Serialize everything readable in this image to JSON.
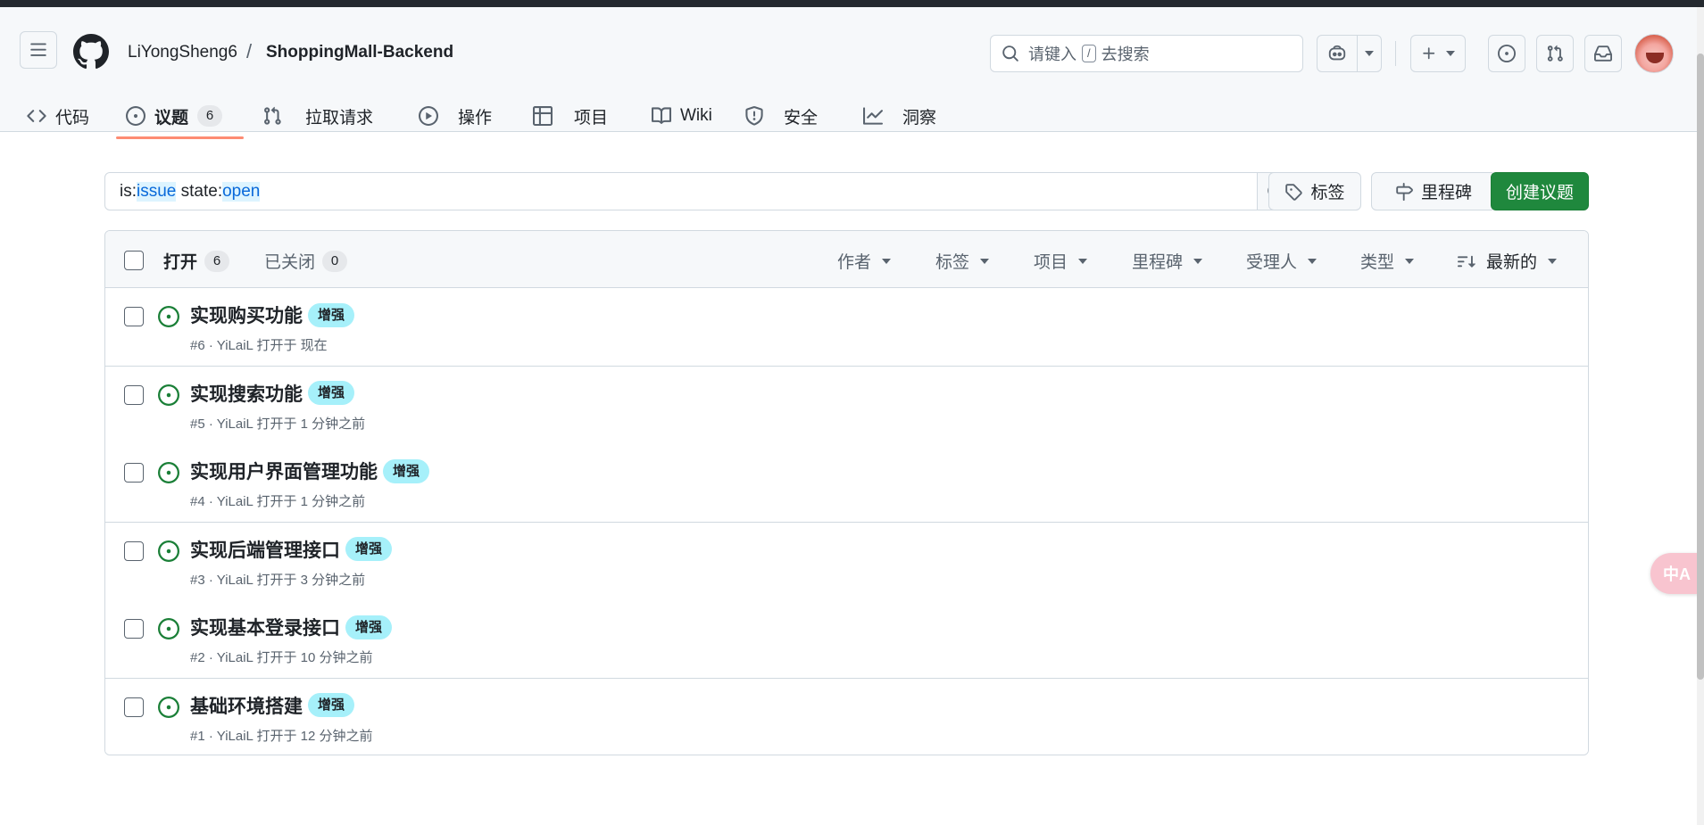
{
  "header": {
    "owner": "LiYongSheng6",
    "separator": "/",
    "repo": "ShoppingMall-Backend",
    "search": {
      "prefix": "请键入",
      "slash": "/",
      "suffix": "去搜索"
    }
  },
  "tabs": [
    {
      "label": "代码",
      "icon": "code-icon"
    },
    {
      "label": "议题",
      "icon": "issue-opened-icon",
      "count": "6",
      "active": true
    },
    {
      "label": "拉取请求",
      "icon": "git-pull-request-icon"
    },
    {
      "label": "操作",
      "icon": "play-icon"
    },
    {
      "label": "项目",
      "icon": "table-icon"
    },
    {
      "label": "Wiki",
      "icon": "book-icon"
    },
    {
      "label": "安全",
      "icon": "shield-icon"
    },
    {
      "label": "洞察",
      "icon": "graph-icon"
    }
  ],
  "toolbar": {
    "query": {
      "t1": "is:",
      "k1": "issue",
      "t2": " state:",
      "k2": "open"
    },
    "labels_label": "标签",
    "milestones_label": "里程碑",
    "new_issue_label": "创建议题"
  },
  "list_header": {
    "open_label": "打开",
    "open_count": "6",
    "closed_label": "已关闭",
    "closed_count": "0",
    "filters": [
      "作者",
      "标签",
      "项目",
      "里程碑",
      "受理人",
      "类型"
    ],
    "sort_label": "最新的"
  },
  "issues": [
    {
      "title": "实现购买功能",
      "label": "增强",
      "meta": "#6 · YiLaiL 打开于 现在"
    },
    {
      "title": "实现搜索功能",
      "label": "增强",
      "meta": "#5 · YiLaiL 打开于 1 分钟之前"
    },
    {
      "title": "实现用户界面管理功能",
      "label": "增强",
      "meta": "#4 · YiLaiL 打开于 1 分钟之前"
    },
    {
      "title": "实现后端管理接口",
      "label": "增强",
      "meta": "#3 · YiLaiL 打开于 3 分钟之前"
    },
    {
      "title": "实现基本登录接口",
      "label": "增强",
      "meta": "#2 · YiLaiL 打开于 10 分钟之前"
    },
    {
      "title": "基础环境搭建",
      "label": "增强",
      "meta": "#1 · YiLaiL 打开于 12 分钟之前"
    }
  ],
  "translate_fab": "中A",
  "colors": {
    "accent_green": "#1f883d",
    "open_icon": "#1a7f37",
    "label_bg": "#a6f0fa",
    "tab_underline": "#fd8c73",
    "link_blue": "#0969da"
  }
}
